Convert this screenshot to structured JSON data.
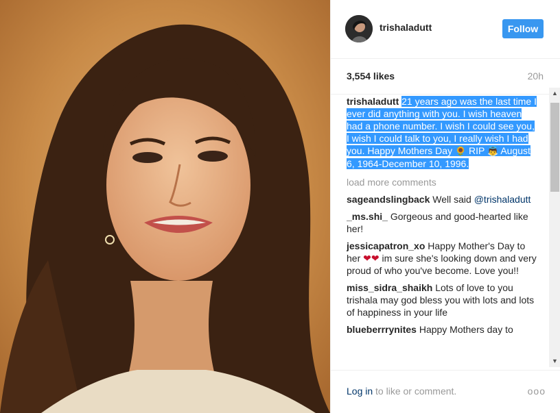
{
  "post": {
    "username": "trishaladutt",
    "follow_label": "Follow",
    "likes": "3,554 likes",
    "time": "20h"
  },
  "caption": {
    "username": "trishaladutt",
    "text_before": "21 years ago was the last time I ever did anything with you. I wish heaven had a phone number. I wish I could see you, I wish I could talk to you, I really wish I had you. Happy Mothers Day",
    "emoji_1": "🌻",
    "text_mid": "RIP",
    "emoji_2": "👼",
    "text_after": "August 6, 1964-December 10, 1996."
  },
  "load_more": "load more comments",
  "comments": [
    {
      "username": "sageandslingback",
      "text": "Well said",
      "mention": "@trishaladutt"
    },
    {
      "username": "_ms.shi_",
      "text": "Gorgeous and good-hearted like her!"
    },
    {
      "username": "jessicapatron_xo",
      "text_before": "Happy Mother's Day to her",
      "hearts": "❤❤",
      "text_after": "im sure she's looking down and very proud of who you've become. Love you!!"
    },
    {
      "username": "miss_sidra_shaikh",
      "text": "Lots of love to you trishala may god bless you with lots and lots of happiness in your life"
    },
    {
      "username": "blueberrrynites",
      "text": "Happy Mothers day to"
    }
  ],
  "footer": {
    "login": "Log in",
    "login_suffix": "to like or comment.",
    "more": "ooo"
  },
  "colors": {
    "follow_button": "#3897f0",
    "selection": "#3399ff",
    "link": "#003569",
    "muted": "#999999"
  }
}
